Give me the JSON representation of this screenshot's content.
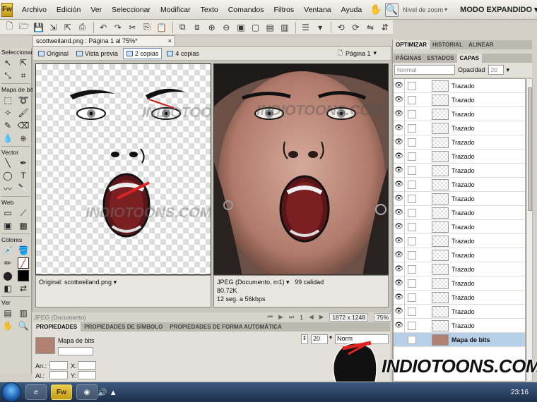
{
  "app": {
    "logo": "Fw",
    "menus": [
      "Archivo",
      "Edición",
      "Ver",
      "Seleccionar",
      "Modificar",
      "Texto",
      "Comandos",
      "Filtros",
      "Ventana",
      "Ayuda"
    ],
    "zoom_level_label": "Nivel de zoom",
    "workspace": "MODO EXPANDIDO ▾"
  },
  "tools": {
    "sections": {
      "select": "Seleccionar",
      "bitmap": "Mapa de bits",
      "vector": "Vector",
      "web": "Web",
      "colors": "Colores",
      "view": "Ver"
    }
  },
  "document": {
    "tab_title": "scottweiland.png : Página 1 al 75%*",
    "tab_close": "×",
    "views": {
      "original": "Original",
      "preview": "Vista previa",
      "two_up": "2 copias",
      "four_up": "4 copias"
    },
    "page_selector": "Página 1",
    "watermark": "INDIOTOONS.COM",
    "original_info": "Original: scottweiland.png",
    "jpeg_info": {
      "format": "JPEG (Documento, m1)",
      "quality": "99 calidad",
      "size": "80.72K",
      "time": "12 seg. a 56kbps"
    }
  },
  "status": {
    "left": "JPEG (Documento)",
    "page": "1",
    "size": "1872 x 1248",
    "zoom": "75%"
  },
  "properties": {
    "tabs": [
      "PROPIEDADES",
      "PROPIEDADES DE SÍMBOLO",
      "PROPIEDADES DE FORMA AUTOMÁTICA"
    ],
    "type": "Mapa de bits",
    "w_label": "An.:",
    "h_label": "Al.:",
    "x_label": "X:",
    "y_label": "Y:",
    "opacity": "20",
    "blend": "Norm"
  },
  "panels": {
    "top_tabs": [
      "OPTIMIZAR",
      "HISTORIAL",
      "ALINEAR"
    ],
    "layer_tabs": [
      "PÁGINAS",
      "ESTADOS",
      "CAPAS"
    ],
    "blend_mode": "Normal",
    "opacity_label": "Opacidad",
    "opacity_value": "20",
    "layers": [
      {
        "name": "Trazado"
      },
      {
        "name": "Trazado"
      },
      {
        "name": "Trazado"
      },
      {
        "name": "Trazado"
      },
      {
        "name": "Trazado"
      },
      {
        "name": "Trazado"
      },
      {
        "name": "Trazado"
      },
      {
        "name": "Trazado"
      },
      {
        "name": "Trazado"
      },
      {
        "name": "Trazado"
      },
      {
        "name": "Trazado"
      },
      {
        "name": "Trazado"
      },
      {
        "name": "Trazado"
      },
      {
        "name": "Trazado"
      },
      {
        "name": "Trazado"
      },
      {
        "name": "Trazado"
      },
      {
        "name": "Trazado"
      },
      {
        "name": "Trazado"
      }
    ],
    "selected_layer": "Mapa de bits"
  },
  "taskbar": {
    "clock": "23:16"
  },
  "brand_watermark": "INDIOTOONS.COM",
  "colors": {
    "accent": "#b8cfea",
    "mouth_red": "#7a1f22",
    "stroke_red": "#d22"
  }
}
